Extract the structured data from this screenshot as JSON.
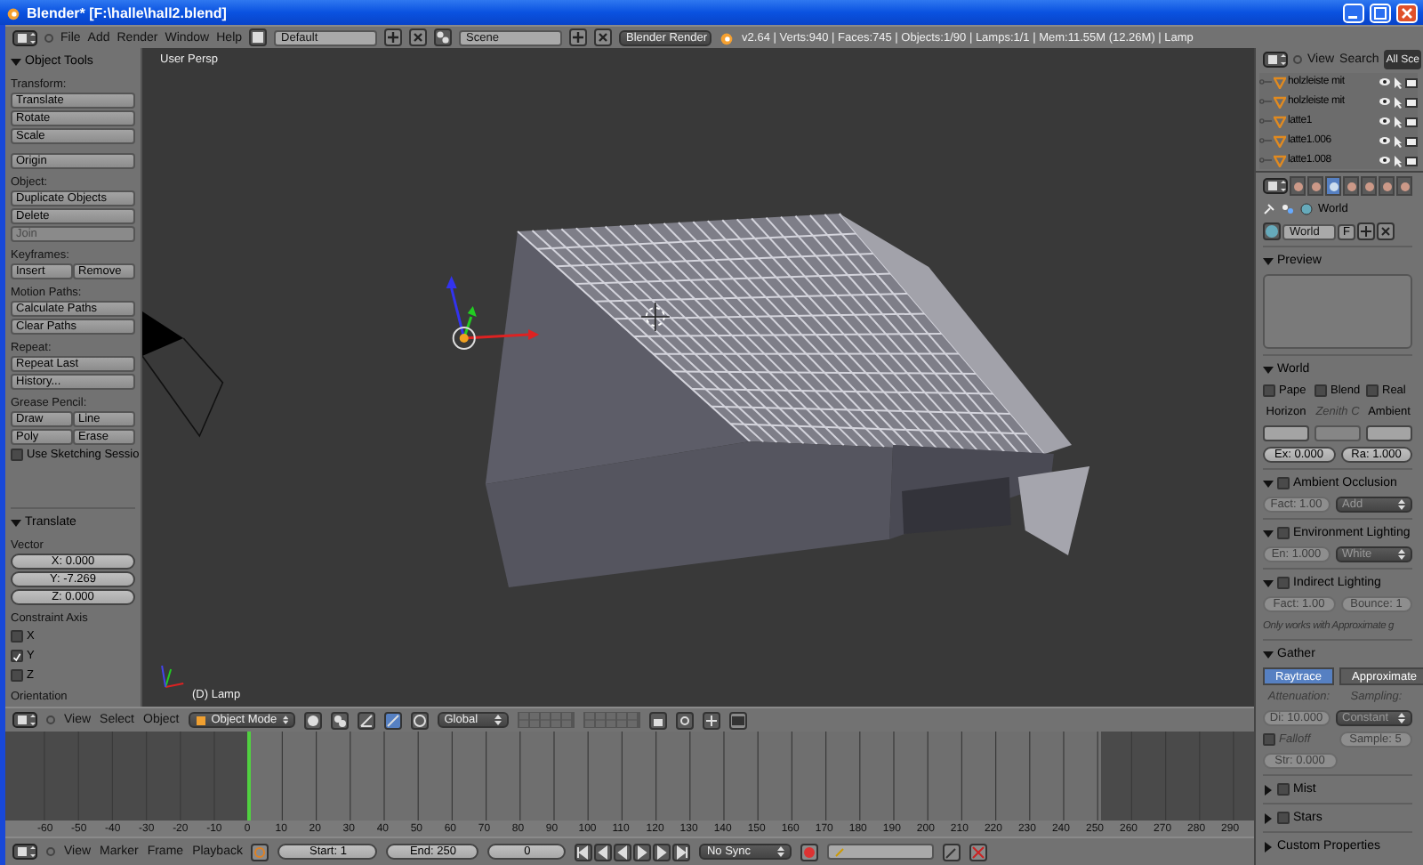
{
  "window": {
    "title": "Blender* [F:\\halle\\hall2.blend]"
  },
  "info_header": {
    "menus": [
      "File",
      "Add",
      "Render",
      "Window",
      "Help"
    ],
    "layout": "Default",
    "scene": "Scene",
    "engine": "Blender Render",
    "stats": "v2.64 | Verts:940 | Faces:745 | Objects:1/90 | Lamps:1/1 | Mem:11.55M (12.26M) | Lamp"
  },
  "tool_shelf": {
    "title": "Object Tools",
    "expanded": true,
    "groups": [
      {
        "label": "Transform:",
        "rows": [
          [
            {
              "kind": "button",
              "text": "Translate",
              "disabled": false
            }
          ],
          [
            {
              "kind": "button",
              "text": "Rotate",
              "disabled": false
            }
          ],
          [
            {
              "kind": "button",
              "text": "Scale",
              "disabled": false
            }
          ]
        ]
      },
      {
        "rows": [
          [
            {
              "kind": "button",
              "text": "Origin",
              "disabled": false
            }
          ]
        ]
      },
      {
        "label": "Object:",
        "rows": [
          [
            {
              "kind": "button",
              "text": "Duplicate Objects",
              "disabled": false
            }
          ],
          [
            {
              "kind": "button",
              "text": "Delete",
              "disabled": false
            }
          ],
          [
            {
              "kind": "button",
              "text": "Join",
              "disabled": true
            }
          ]
        ]
      },
      {
        "label": "Keyframes:",
        "rows": [
          [
            {
              "kind": "button",
              "text": "Insert",
              "disabled": false
            },
            {
              "kind": "button",
              "text": "Remove",
              "disabled": false
            }
          ]
        ]
      },
      {
        "label": "Motion Paths:",
        "rows": [
          [
            {
              "kind": "button",
              "text": "Calculate Paths",
              "disabled": false
            }
          ],
          [
            {
              "kind": "button",
              "text": "Clear Paths",
              "disabled": false
            }
          ]
        ]
      },
      {
        "label": "Repeat:",
        "rows": [
          [
            {
              "kind": "button",
              "text": "Repeat Last",
              "disabled": false
            }
          ],
          [
            {
              "kind": "button",
              "text": "History...",
              "disabled": false
            }
          ]
        ]
      },
      {
        "label": "Grease Pencil:",
        "rows": [
          [
            {
              "kind": "button",
              "text": "Draw",
              "disabled": false
            },
            {
              "kind": "button",
              "text": "Line",
              "disabled": false
            }
          ],
          [
            {
              "kind": "button",
              "text": "Poly",
              "disabled": false
            },
            {
              "kind": "button",
              "text": "Erase",
              "disabled": false
            }
          ],
          [
            {
              "kind": "checkbox",
              "text": "Use Sketching Sessio",
              "checked": false,
              "disabled": false
            }
          ]
        ]
      }
    ]
  },
  "operator_panel": {
    "title": "Translate",
    "expanded": true,
    "vector_label": "Vector",
    "fields": [
      "X: 0.000",
      "Y: -7.269",
      "Z: 0.000"
    ],
    "axis_label": "Constraint Axis",
    "axes": [
      {
        "label": "X",
        "checked": false
      },
      {
        "label": "Y",
        "checked": true
      },
      {
        "label": "Z",
        "checked": false
      }
    ],
    "orientation_label": "Orientation"
  },
  "viewport": {
    "view_name": "User Persp",
    "object_label": "(D) Lamp"
  },
  "view3d_header": {
    "menus": [
      "View",
      "Select",
      "Object"
    ],
    "mode": "Object Mode",
    "orientation": "Global"
  },
  "timeline": {
    "ticks": [
      "-60",
      "-50",
      "-40",
      "-30",
      "-20",
      "-10",
      "0",
      "10",
      "20",
      "30",
      "40",
      "50",
      "60",
      "70",
      "80",
      "90",
      "100",
      "110",
      "120",
      "130",
      "140",
      "150",
      "160",
      "170",
      "180",
      "190",
      "200",
      "210",
      "220",
      "230",
      "240",
      "250",
      "260",
      "270",
      "280",
      "290"
    ]
  },
  "timeline_header": {
    "menus": [
      "View",
      "Marker",
      "Frame",
      "Playback"
    ],
    "start": "Start: 1",
    "end": "End: 250",
    "frame": "0",
    "sync": "No Sync"
  },
  "outliner": {
    "menus": [
      "View",
      "Search"
    ],
    "scope": "All Sce",
    "items": [
      {
        "name": "holzleiste mit"
      },
      {
        "name": "holzleiste mit"
      },
      {
        "name": "latte1"
      },
      {
        "name": "latte1.006"
      },
      {
        "name": "latte1.008"
      }
    ]
  },
  "properties": {
    "tabs": [
      {
        "selected": false
      },
      {
        "selected": false
      },
      {
        "selected": true
      },
      {
        "selected": false
      },
      {
        "selected": false
      },
      {
        "selected": false
      },
      {
        "selected": false
      }
    ],
    "context": "World",
    "world_name": "World",
    "user_toggle": "F",
    "panels": [
      {
        "title": "Preview",
        "kind": "plain",
        "expanded": true,
        "rows": [
          [
            {
              "kind": "preview"
            }
          ]
        ]
      },
      {
        "title": "World",
        "kind": "plain",
        "expanded": true,
        "rows": [
          [
            {
              "kind": "checkbox",
              "text": "Pape",
              "checked": false,
              "disabled": false
            },
            {
              "kind": "checkbox",
              "text": "Blend",
              "checked": false,
              "disabled": false
            },
            {
              "kind": "checkbox",
              "text": "Real",
              "checked": false,
              "disabled": false
            }
          ],
          [
            {
              "kind": "label",
              "text": "Horizon",
              "disabled": false
            },
            {
              "kind": "label",
              "text": "Zenith C",
              "disabled": true
            },
            {
              "kind": "label",
              "text": "Ambient",
              "disabled": false
            }
          ],
          [
            {
              "kind": "color",
              "disabled": false
            },
            {
              "kind": "color",
              "disabled": true
            },
            {
              "kind": "color",
              "disabled": false
            }
          ],
          [
            {
              "kind": "field",
              "text": "Ex: 0.000",
              "disabled": false
            },
            {
              "kind": "field",
              "text": "Ra: 1.000",
              "disabled": false
            }
          ]
        ]
      },
      {
        "title": "Ambient Occlusion",
        "kind": "toggle",
        "enabled": false,
        "expanded": true,
        "rows": [
          [
            {
              "kind": "field",
              "text": "Fact: 1.00",
              "disabled": true
            },
            {
              "kind": "dropdown",
              "text": "Add",
              "disabled": true
            }
          ]
        ]
      },
      {
        "title": "Environment Lighting",
        "kind": "toggle",
        "enabled": false,
        "expanded": true,
        "rows": [
          [
            {
              "kind": "field",
              "text": "En: 1.000",
              "disabled": true
            },
            {
              "kind": "dropdown",
              "text": "White",
              "disabled": true
            }
          ]
        ]
      },
      {
        "title": "Indirect Lighting",
        "kind": "toggle",
        "enabled": false,
        "expanded": true,
        "rows": [
          [
            {
              "kind": "field",
              "text": "Fact: 1.00",
              "disabled": true
            },
            {
              "kind": "field",
              "text": "Bounce: 1",
              "disabled": true
            }
          ],
          [
            {
              "kind": "note",
              "text": "Only works with Approximate g",
              "disabled": true
            }
          ]
        ]
      },
      {
        "title": "Gather",
        "kind": "plain",
        "expanded": true,
        "rows": [
          [
            {
              "kind": "segment",
              "text": "Raytrace",
              "selected": true
            },
            {
              "kind": "segment",
              "text": "Approximate",
              "selected": false
            }
          ],
          [
            {
              "kind": "label",
              "text": "Attenuation:",
              "disabled": true
            },
            {
              "kind": "label",
              "text": "Sampling:",
              "disabled": true
            }
          ],
          [
            {
              "kind": "field",
              "text": "Di: 10.000",
              "disabled": true
            },
            {
              "kind": "dropdown",
              "text": "Constant",
              "disabled": true
            }
          ],
          [
            {
              "kind": "checkbox",
              "text": "Falloff",
              "checked": false,
              "disabled": true
            },
            {
              "kind": "field",
              "text": "Sample: 5",
              "disabled": true
            }
          ],
          [
            {
              "kind": "field",
              "text": "Str: 0.000",
              "disabled": true
            },
            {
              "kind": "empty"
            }
          ]
        ]
      },
      {
        "title": "Mist",
        "kind": "toggle",
        "enabled": false,
        "expanded": false
      },
      {
        "title": "Stars",
        "kind": "toggle",
        "enabled": false,
        "expanded": false
      },
      {
        "title": "Custom Properties",
        "kind": "plain",
        "expanded": false
      }
    ]
  }
}
